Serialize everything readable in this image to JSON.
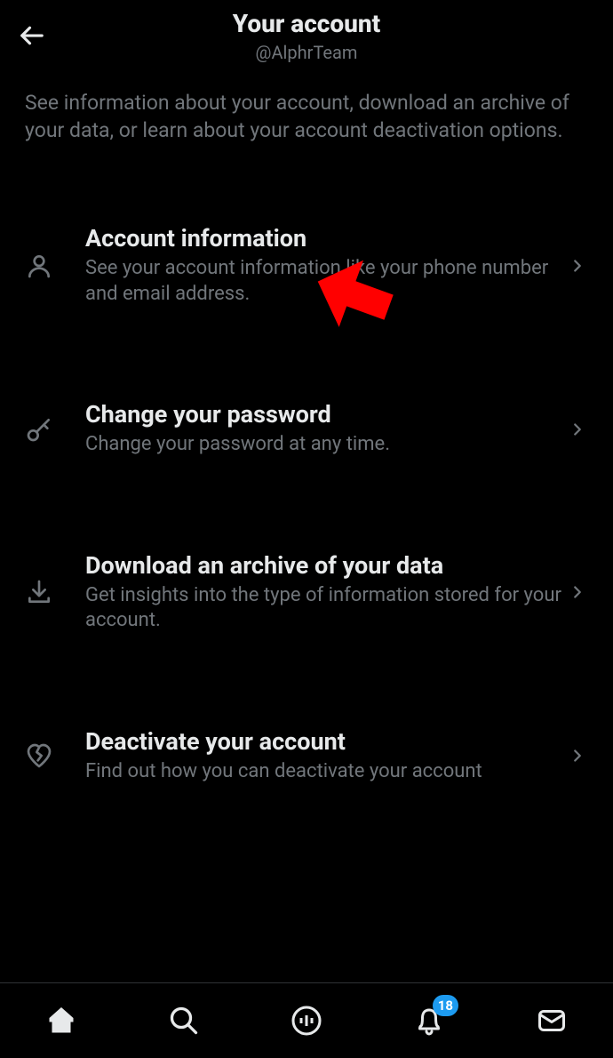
{
  "header": {
    "title": "Your account",
    "subtitle": "@AlphrTeam"
  },
  "description": "See information about your account, download an archive of your data, or learn about your account deactivation options.",
  "menu": [
    {
      "icon": "person-icon",
      "title": "Account information",
      "desc": "See your account information like your phone number and email address."
    },
    {
      "icon": "key-icon",
      "title": "Change your password",
      "desc": "Change your password at any time."
    },
    {
      "icon": "download-icon",
      "title": "Download an archive of your data",
      "desc": "Get insights into the type of information stored for your account."
    },
    {
      "icon": "heartbreak-icon",
      "title": "Deactivate your account",
      "desc": "Find out how you can deactivate your account"
    }
  ],
  "nav": {
    "badge_count": "18"
  },
  "annotation": {
    "color": "#ff0000"
  }
}
